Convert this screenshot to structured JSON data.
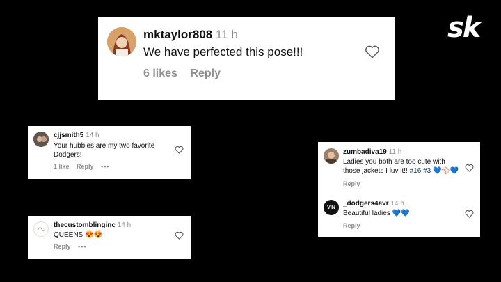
{
  "logo": {
    "text": "sk"
  },
  "comments": {
    "main": {
      "username": "mktaylor808",
      "time": "11 h",
      "text": "We have perfected this pose!!!",
      "likes": "6 likes",
      "reply": "Reply"
    },
    "cj": {
      "username": "cjjsmith5",
      "time": "14 h",
      "text": "Your hubbies are my two favorite Dodgers!",
      "likes": "1 like",
      "reply": "Reply",
      "more": "•••"
    },
    "custom": {
      "username": "thecustomblinginc",
      "time": "14 h",
      "text": "QUEENS 😍😍",
      "reply": "Reply",
      "more": "•••"
    },
    "zumba": {
      "username": "zumbadiva19",
      "time": "11 h",
      "text_before": "Ladies you both are too cute with those jackets I luv it!! ",
      "hashtags": "#16 #3",
      "emoji": " 💙⚾💙",
      "reply": "Reply"
    },
    "dodgers": {
      "username": "_dodgers4evr",
      "time": "14 h",
      "avatar_text": "VIN",
      "text": "Beautiful ladies 💙💙",
      "reply": "Reply"
    }
  },
  "colors": {
    "background": "#000000",
    "card": "#ffffff",
    "meta": "#8e8e8e"
  }
}
